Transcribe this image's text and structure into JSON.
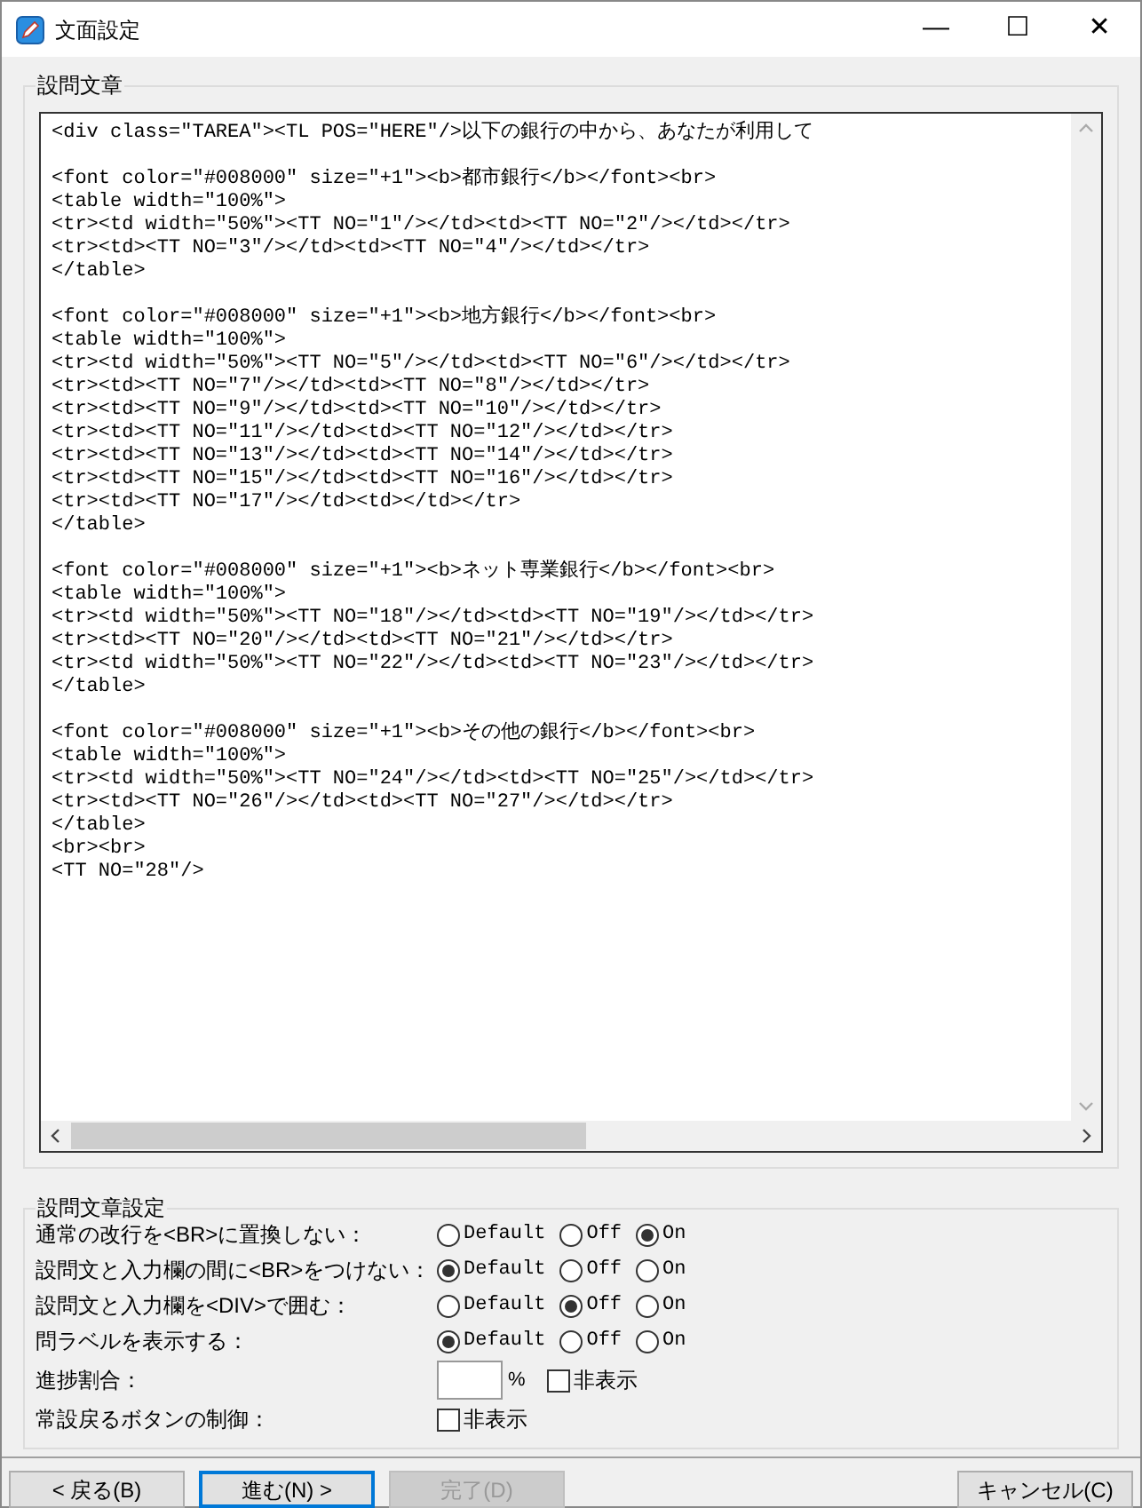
{
  "window": {
    "title": "文面設定",
    "controls": [
      "—",
      "☐",
      "✕"
    ]
  },
  "question_group": {
    "label": "設問文章",
    "blocks": [
      [
        "<div class=\"TAREA\"><TL POS=\"HERE\"/>以下の銀行の中から、あなたが利用して"
      ],
      [
        "<font color=\"#008000\" size=\"+1\"><b>都市銀行</b></font><br>",
        "<table width=\"100%\">",
        "<tr><td width=\"50%\"><TT NO=\"1\"/></td><td><TT NO=\"2\"/></td></tr>",
        "<tr><td><TT NO=\"3\"/></td><td><TT NO=\"4\"/></td></tr>",
        "</table>"
      ],
      [
        "<font color=\"#008000\" size=\"+1\"><b>地方銀行</b></font><br>",
        "<table width=\"100%\">",
        "<tr><td width=\"50%\"><TT NO=\"5\"/></td><td><TT NO=\"6\"/></td></tr>",
        "<tr><td><TT NO=\"7\"/></td><td><TT NO=\"8\"/></td></tr>",
        "<tr><td><TT NO=\"9\"/></td><td><TT NO=\"10\"/></td></tr>",
        "<tr><td><TT NO=\"11\"/></td><td><TT NO=\"12\"/></td></tr>",
        "<tr><td><TT NO=\"13\"/></td><td><TT NO=\"14\"/></td></tr>",
        "<tr><td><TT NO=\"15\"/></td><td><TT NO=\"16\"/></td></tr>",
        "<tr><td><TT NO=\"17\"/></td><td></td></tr>",
        "</table>"
      ],
      [
        "<font color=\"#008000\" size=\"+1\"><b>ネット専業銀行</b></font><br>",
        "<table width=\"100%\">",
        "<tr><td width=\"50%\"><TT NO=\"18\"/></td><td><TT NO=\"19\"/></td></tr>",
        "<tr><td><TT NO=\"20\"/></td><td><TT NO=\"21\"/></td></tr>",
        "<tr><td width=\"50%\"><TT NO=\"22\"/></td><td><TT NO=\"23\"/></td></tr>",
        "</table>"
      ],
      [
        "<font color=\"#008000\" size=\"+1\"><b>その他の銀行</b></font><br>",
        "<table width=\"100%\">",
        "<tr><td width=\"50%\"><TT NO=\"24\"/></td><td><TT NO=\"25\"/></td></tr>",
        "<tr><td><TT NO=\"26\"/></td><td><TT NO=\"27\"/></td></tr>",
        "</table>",
        "<br><br>",
        "<TT NO=\"28\"/>"
      ]
    ]
  },
  "settings_group": {
    "label": "設問文章設定",
    "rows": [
      {
        "kind": "radio",
        "label": "通常の改行を<BR>に置換しない：",
        "options": [
          {
            "label": "Default",
            "selected": false
          },
          {
            "label": "Off",
            "selected": false
          },
          {
            "label": "On",
            "selected": true
          }
        ]
      },
      {
        "kind": "radio",
        "label": "設問文と入力欄の間に<BR>をつけない：",
        "options": [
          {
            "label": "Default",
            "selected": true
          },
          {
            "label": "Off",
            "selected": false
          },
          {
            "label": "On",
            "selected": false
          }
        ]
      },
      {
        "kind": "radio",
        "label": "設問文と入力欄を<DIV>で囲む：",
        "options": [
          {
            "label": "Default",
            "selected": false
          },
          {
            "label": "Off",
            "selected": true
          },
          {
            "label": "On",
            "selected": false
          }
        ]
      },
      {
        "kind": "radio",
        "label": "問ラベルを表示する：",
        "options": [
          {
            "label": "Default",
            "selected": true
          },
          {
            "label": "Off",
            "selected": false
          },
          {
            "label": "On",
            "selected": false
          }
        ]
      },
      {
        "kind": "percent",
        "label": "進捗割合：",
        "unit": "%",
        "checkbox": {
          "label": "非表示",
          "checked": false
        }
      },
      {
        "kind": "checkbox",
        "label": "常設戻るボタンの制御：",
        "checkbox": {
          "label": "非表示",
          "checked": false
        }
      }
    ]
  },
  "buttons": [
    {
      "label": "< 戻る(B)",
      "disabled": false,
      "focused": false
    },
    {
      "label": "進む(N) >",
      "disabled": false,
      "focused": true
    },
    {
      "label": "完了(D)",
      "disabled": true,
      "focused": false
    },
    {
      "label": "キャンセル(C)",
      "disabled": false,
      "focused": false
    }
  ]
}
